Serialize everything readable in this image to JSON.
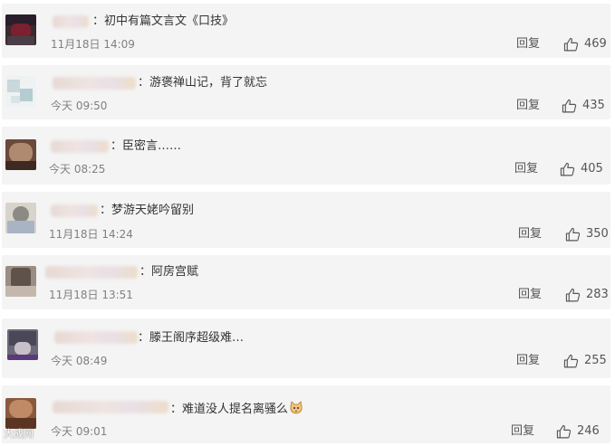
{
  "comments": [
    {
      "text": "：初中有篇文言文《口技》",
      "time": "11月18日 14:09",
      "reply_label": "回复",
      "likes": "469"
    },
    {
      "text": "：游褒禅山记，背了就忘",
      "time": "今天 09:50",
      "reply_label": "回复",
      "likes": "435"
    },
    {
      "text": "：臣密言……",
      "time": "今天 08:25",
      "reply_label": "回复",
      "likes": "405"
    },
    {
      "text": "：梦游天姥吟留别",
      "time": "11月18日 14:24",
      "reply_label": "回复",
      "likes": "350"
    },
    {
      "text": "：阿房宫赋",
      "time": "11月18日 13:51",
      "reply_label": "回复",
      "likes": "283"
    },
    {
      "text": "：滕王阁序超级难…",
      "time": "今天 08:49",
      "reply_label": "回复",
      "likes": "255"
    },
    {
      "text": "：难道没人提名离骚么",
      "time": "今天 09:01",
      "reply_label": "回复",
      "likes": "246"
    }
  ],
  "icons": {
    "like": "thumbs-up-icon",
    "emoji": "cat-face-icon"
  },
  "colors": {
    "card_bg": "#f4f4f4",
    "text": "#333333",
    "meta": "#808080"
  },
  "watermark": "大成网"
}
